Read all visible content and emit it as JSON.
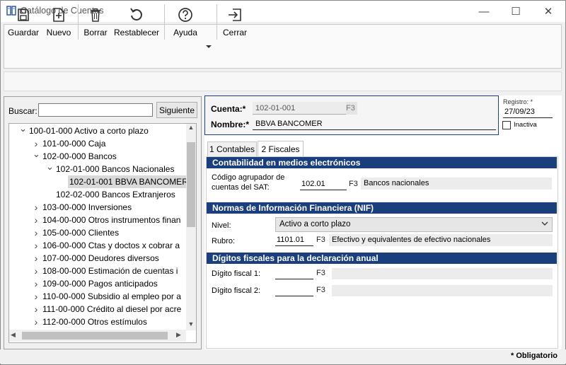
{
  "window": {
    "title": "Catálogo de Cuentas",
    "minimize": "—",
    "maximize": "☐",
    "close": "✕"
  },
  "toolbar": {
    "guardar": "Guardar",
    "nuevo": "Nuevo",
    "borrar": "Borrar",
    "restablecer": "Restablecer",
    "ayuda": "Ayuda",
    "cerrar": "Cerrar"
  },
  "search": {
    "label": "Buscar:",
    "value": "",
    "button": "Siguiente"
  },
  "tree": [
    {
      "label": "100-01-000 Activo a corto plazo",
      "level": 0,
      "state": "expanded"
    },
    {
      "label": "101-00-000 Caja",
      "level": 1,
      "state": "collapsed"
    },
    {
      "label": "102-00-000 Bancos",
      "level": 1,
      "state": "expanded"
    },
    {
      "label": "102-01-000 Bancos Nacionales",
      "level": 2,
      "state": "expanded"
    },
    {
      "label": "102-01-001 BBVA BANCOMER",
      "level": 3,
      "state": "leaf",
      "selected": true
    },
    {
      "label": "102-02-000 Bancos Extranjeros",
      "level": 2,
      "state": "leaf"
    },
    {
      "label": "103-00-000 Inversiones",
      "level": 1,
      "state": "collapsed"
    },
    {
      "label": "104-00-000 Otros instrumentos finan",
      "level": 1,
      "state": "collapsed"
    },
    {
      "label": "105-00-000 Clientes",
      "level": 1,
      "state": "collapsed"
    },
    {
      "label": "106-00-000 Ctas y doctos x cobrar a",
      "level": 1,
      "state": "collapsed"
    },
    {
      "label": "107-00-000 Deudores diversos",
      "level": 1,
      "state": "collapsed"
    },
    {
      "label": "108-00-000 Estimación de cuentas i",
      "level": 1,
      "state": "collapsed"
    },
    {
      "label": "109-00-000 Pagos anticipados",
      "level": 1,
      "state": "collapsed"
    },
    {
      "label": "110-00-000 Subsidio al empleo por a",
      "level": 1,
      "state": "collapsed"
    },
    {
      "label": "111-00-000 Crédito al diesel por acre",
      "level": 1,
      "state": "collapsed"
    },
    {
      "label": "112-00-000 Otros estímulos",
      "level": 1,
      "state": "collapsed"
    }
  ],
  "cuenta": {
    "label": "Cuenta:*",
    "value": "102-01-001",
    "f3": "F3"
  },
  "nombre": {
    "label": "Nombre:*",
    "value": "BBVA BANCOMER"
  },
  "registro": {
    "label": "Registro: *",
    "value": "27/09/23",
    "inactiva": "Inactiva",
    "inactiva_checked": false
  },
  "tabs": {
    "contables": "1 Contables",
    "fiscales": "2 Fiscales",
    "active": "fiscales"
  },
  "sat": {
    "header": "Contabilidad en medios electrónicos",
    "label_line1": "Código agrupador de",
    "label_line2": "cuentas del SAT:",
    "code": "102.01",
    "f3": "F3",
    "desc": "Bancos nacionales"
  },
  "nif": {
    "header": "Normas de Información Financiera (NIF)",
    "nivel_label": "Nivel:",
    "nivel_value": "Activo a corto plazo",
    "rubro_label": "Rubro:",
    "rubro_code": "1101.01",
    "f3": "F3",
    "rubro_desc": "Efectivo y equivalentes de efectivo nacionales"
  },
  "digitos": {
    "header": "Dígitos fiscales para la declaración anual",
    "d1_label": "Dígito fiscal 1:",
    "d1_value": "",
    "d2_label": "Dígito fiscal 2:",
    "d2_value": "",
    "f3": "F3"
  },
  "status": {
    "obligatorio": "* Obligatorio"
  },
  "colors": {
    "section_header": "#1b3f7c",
    "cuenta_border": "#1f3f8c",
    "selection": "#d9d9d9"
  }
}
